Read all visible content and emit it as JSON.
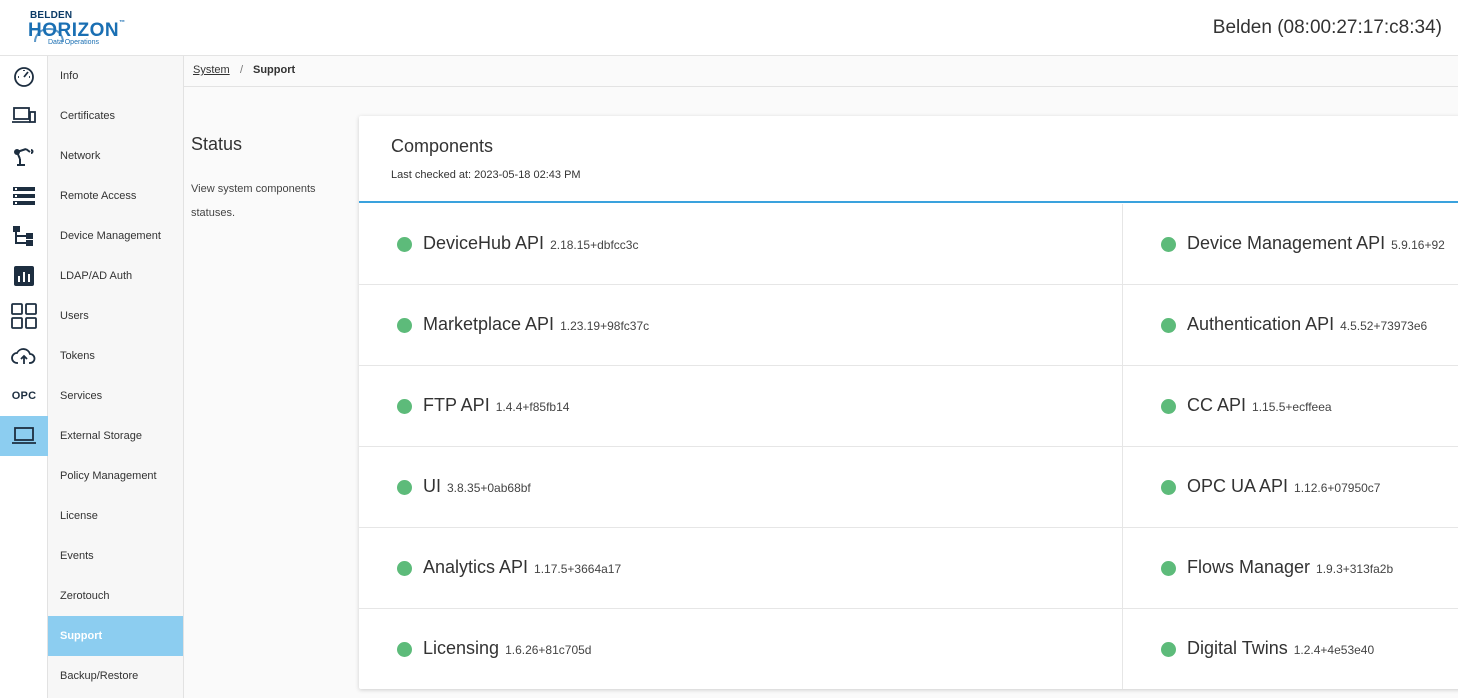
{
  "header": {
    "logo": {
      "brand": "BELDEN",
      "product": "HORIZON",
      "tm": "™",
      "tagline": "Data Operations"
    },
    "device_id": "Belden (08:00:27:17:c8:34)"
  },
  "rail": [
    {
      "name": "dashboard-gauge-icon"
    },
    {
      "name": "devices-icon"
    },
    {
      "name": "robot-arm-icon"
    },
    {
      "name": "list-icon"
    },
    {
      "name": "hierarchy-icon"
    },
    {
      "name": "analytics-icon"
    },
    {
      "name": "apps-grid-icon"
    },
    {
      "name": "cloud-upload-icon"
    },
    {
      "name": "opc-icon",
      "label": "OPC"
    },
    {
      "name": "laptop-icon",
      "active": true
    }
  ],
  "submenu": {
    "items": [
      {
        "label": "Info"
      },
      {
        "label": "Certificates"
      },
      {
        "label": "Network"
      },
      {
        "label": "Remote Access"
      },
      {
        "label": "Device Management"
      },
      {
        "label": "LDAP/AD Auth"
      },
      {
        "label": "Users"
      },
      {
        "label": "Tokens"
      },
      {
        "label": "Services"
      },
      {
        "label": "External Storage"
      },
      {
        "label": "Policy Management"
      },
      {
        "label": "License"
      },
      {
        "label": "Events"
      },
      {
        "label": "Zerotouch"
      },
      {
        "label": "Support",
        "active": true
      },
      {
        "label": "Backup/Restore"
      }
    ]
  },
  "breadcrumb": {
    "parent": "System",
    "separator": "/",
    "current": "Support"
  },
  "status": {
    "title": "Status",
    "description": "View system components statuses."
  },
  "components": {
    "title": "Components",
    "last_checked": "Last checked at: 2023-05-18 02:43 PM",
    "status_color": "#5dbb7a",
    "rows": [
      [
        {
          "name": "DeviceHub API",
          "version": "2.18.15+dbfcc3c"
        },
        {
          "name": "Device Management API",
          "version": "5.9.16+92"
        }
      ],
      [
        {
          "name": "Marketplace API",
          "version": "1.23.19+98fc37c"
        },
        {
          "name": "Authentication API",
          "version": "4.5.52+73973e6"
        }
      ],
      [
        {
          "name": "FTP API",
          "version": "1.4.4+f85fb14"
        },
        {
          "name": "CC API",
          "version": "1.15.5+ecffeea"
        }
      ],
      [
        {
          "name": "UI",
          "version": "3.8.35+0ab68bf"
        },
        {
          "name": "OPC UA API",
          "version": "1.12.6+07950c7"
        }
      ],
      [
        {
          "name": "Analytics API",
          "version": "1.17.5+3664a17"
        },
        {
          "name": "Flows Manager",
          "version": "1.9.3+313fa2b"
        }
      ],
      [
        {
          "name": "Licensing",
          "version": "1.6.26+81c705d"
        },
        {
          "name": "Digital Twins",
          "version": "1.2.4+4e53e40"
        }
      ]
    ]
  }
}
